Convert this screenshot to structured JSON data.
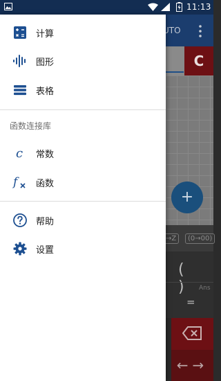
{
  "status_bar": {
    "time": "11:13"
  },
  "app": {
    "mode_label": "UTO",
    "clear_label": "C",
    "fab_label": "+",
    "key_hint_1": "→Z",
    "key_hint_2": "(0→00)",
    "parens": "( )",
    "ans_label": "Ans",
    "equals_label": "=",
    "arrows_label": "←→"
  },
  "drawer": {
    "items": [
      {
        "label": "计算",
        "icon": "calculator-icon"
      },
      {
        "label": "图形",
        "icon": "waveform-icon"
      },
      {
        "label": "表格",
        "icon": "table-icon"
      }
    ],
    "section_title": "函数连接库",
    "library_items": [
      {
        "label": "常数",
        "icon": "constant-c-icon"
      },
      {
        "label": "函数",
        "icon": "function-fx-icon"
      }
    ],
    "footer_items": [
      {
        "label": "帮助",
        "icon": "help-icon"
      },
      {
        "label": "设置",
        "icon": "settings-gear-icon"
      }
    ]
  },
  "colors": {
    "status_bar": "#132d52",
    "icon_blue": "#1d4f91",
    "clear_red": "#6d1014"
  }
}
